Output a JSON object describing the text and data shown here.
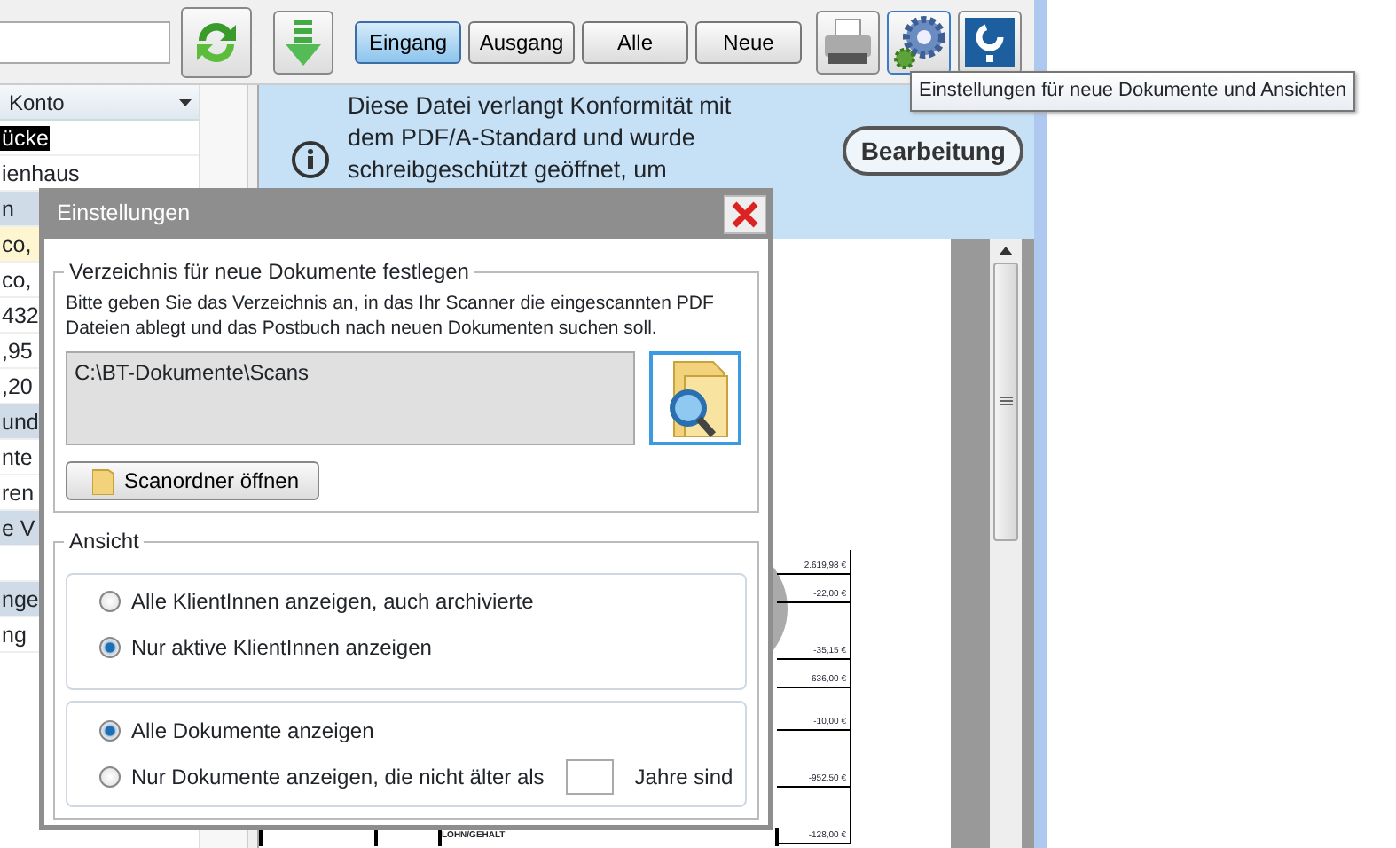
{
  "toolbar": {
    "filters": [
      {
        "label": "Eingang",
        "selected": true
      },
      {
        "label": "Ausgang",
        "selected": false
      },
      {
        "label": "Alle",
        "selected": false
      },
      {
        "label": "Neue",
        "selected": false
      }
    ]
  },
  "tooltip": "Einstellungen für neue Dokumente und Ansichten",
  "list": {
    "column": "Konto",
    "rows": [
      {
        "text": "ücke",
        "kind": "selected"
      },
      {
        "text": "ienhaus",
        "kind": "plain"
      },
      {
        "text": "n",
        "kind": "group"
      },
      {
        "text": "co,",
        "kind": "marked"
      },
      {
        "text": "co,",
        "kind": "plain"
      },
      {
        "text": "432",
        "kind": "plain"
      },
      {
        "text": ",95",
        "kind": "plain"
      },
      {
        "text": ",20",
        "kind": "plain"
      },
      {
        "text": "und",
        "kind": "group"
      },
      {
        "text": "nte",
        "kind": "plain"
      },
      {
        "text": "ren",
        "kind": "plain"
      },
      {
        "text": "e V",
        "kind": "group"
      },
      {
        "text": "",
        "kind": "plain"
      },
      {
        "text": "nge",
        "kind": "group"
      },
      {
        "text": "ng",
        "kind": "plain"
      }
    ]
  },
  "info_bar": {
    "lines": [
      "Diese Datei verlangt Konformität mit",
      "dem PDF/A-Standard und wurde",
      "schreibgeschützt geöffnet, um"
    ],
    "button": "Bearbeitung"
  },
  "document": {
    "amounts": [
      "2.619,98 €",
      "-22,00 €",
      "-35,15 €",
      "-636,00 €",
      "-10,00 €",
      "-952,50 €",
      "-128,00 €"
    ],
    "label": "LOHN/GEHALT"
  },
  "dialog": {
    "title": "Einstellungen",
    "folder_group": {
      "legend": "Verzeichnis für neue Dokumente festlegen",
      "description": "Bitte geben Sie das Verzeichnis an, in das Ihr Scanner die eingescannten PDF Dateien ablegt und das Postbuch nach neuen Dokumenten suchen soll.",
      "path": "C:\\BT-Dokumente\\Scans",
      "open_button": "Scanordner öffnen"
    },
    "view_group": {
      "legend": "Ansicht",
      "client_options": [
        {
          "label": "Alle KlientInnen anzeigen, auch archivierte",
          "selected": false
        },
        {
          "label": "Nur aktive KlientInnen anzeigen",
          "selected": true
        }
      ],
      "document_options": [
        {
          "label": "Alle Dokumente anzeigen",
          "selected": true
        },
        {
          "label": "Nur Dokumente anzeigen, die nicht älter als",
          "selected": false,
          "suffix": "Jahre sind"
        }
      ]
    }
  }
}
